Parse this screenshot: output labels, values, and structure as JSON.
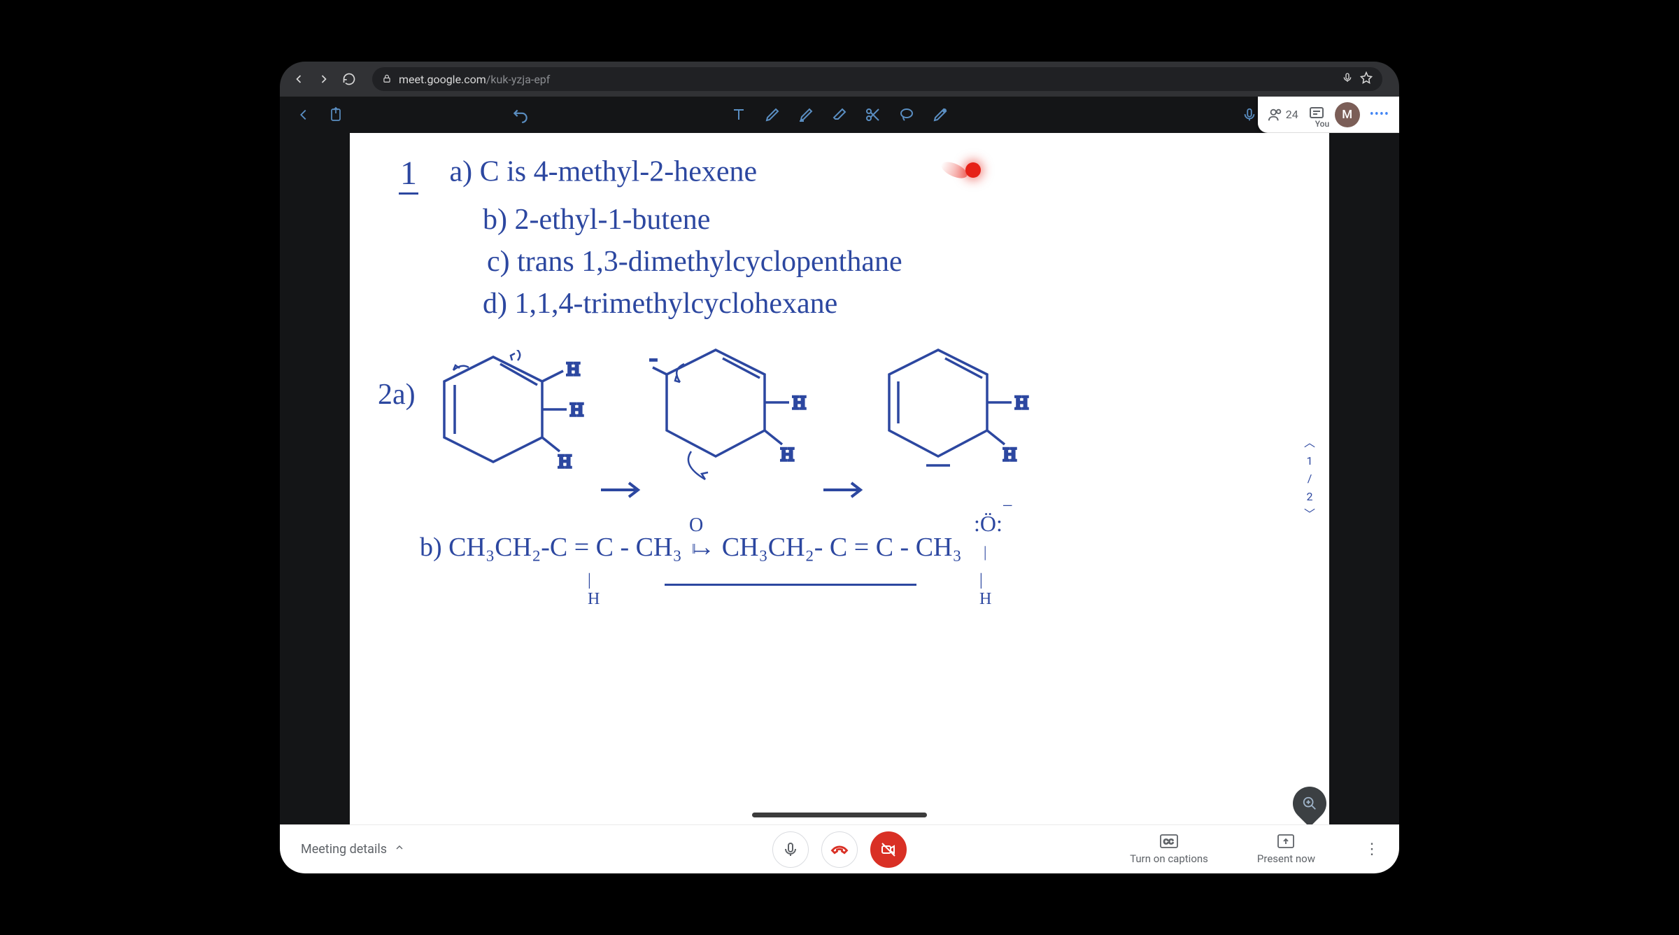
{
  "browser": {
    "url_host": "meet.google.com",
    "url_path": "/kuk-yzja-epf"
  },
  "meet_header": {
    "participant_count": "24",
    "you_label": "You",
    "avatar_initial": "M"
  },
  "whiteboard": {
    "q1": {
      "prefix": "1",
      "a": "a) C is 4-methyl-2-hexene",
      "b": "b) 2-ethyl-1-butene",
      "c": "c) trans 1,3-dimethylcyclopenthane",
      "d": "d) 1,1,4-trimethylcyclohexane"
    },
    "q2_label": "2a)",
    "q2b": "b) CH₃CH₂-C = C - CH₃ → CH₃CH₂- C = C - CH₃",
    "atom_o_lone": ":Ö:",
    "atom_o_top": "O"
  },
  "pager": {
    "cur": "1",
    "sep": "/",
    "tot": "2"
  },
  "bottom": {
    "meeting_details": "Meeting details",
    "captions": "Turn on captions",
    "present": "Present now"
  }
}
